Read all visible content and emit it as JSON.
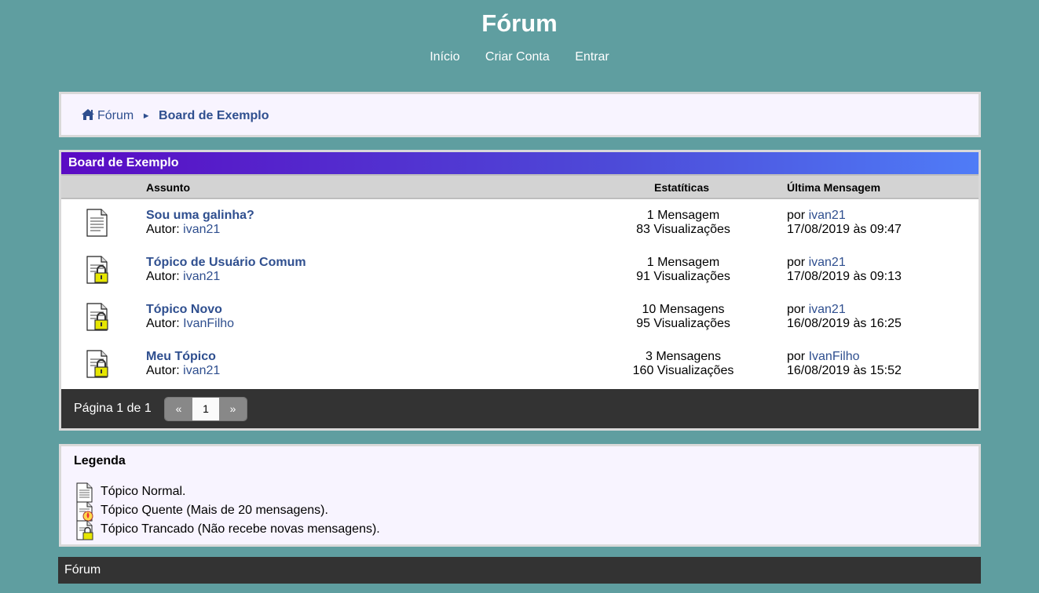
{
  "site": {
    "title": "Fórum"
  },
  "nav": {
    "home": "Início",
    "register": "Criar Conta",
    "login": "Entrar"
  },
  "breadcrumb": {
    "root": "Fórum",
    "separator": "►",
    "current": "Board de Exemplo"
  },
  "board": {
    "title": "Board de Exemplo",
    "columns": {
      "subject": "Assunto",
      "stats": "Estatíticas",
      "last": "Última Mensagem"
    },
    "topics": [
      {
        "icon": "normal-topic-icon",
        "title": "Sou uma galinha?",
        "author_label": "Autor:",
        "author": "ivan21",
        "messages": "1 Mensagem",
        "views": "83 Visualizações",
        "last_by_label": "por",
        "last_by": "ivan21",
        "last_date": "17/08/2019 às 09:47"
      },
      {
        "icon": "locked-topic-icon",
        "title": "Tópico de Usuário Comum",
        "author_label": "Autor:",
        "author": "ivan21",
        "messages": "1 Mensagem",
        "views": "91 Visualizações",
        "last_by_label": "por",
        "last_by": "ivan21",
        "last_date": "17/08/2019 às 09:13"
      },
      {
        "icon": "locked-topic-icon",
        "title": "Tópico Novo",
        "author_label": "Autor:",
        "author": "IvanFilho",
        "messages": "10 Mensagens",
        "views": "95 Visualizações",
        "last_by_label": "por",
        "last_by": "ivan21",
        "last_date": "16/08/2019 às 16:25"
      },
      {
        "icon": "locked-topic-icon",
        "title": "Meu Tópico",
        "author_label": "Autor:",
        "author": "ivan21",
        "messages": "3 Mensagens",
        "views": "160 Visualizações",
        "last_by_label": "por",
        "last_by": "IvanFilho",
        "last_date": "16/08/2019 às 15:52"
      }
    ],
    "pagination": {
      "label": "Página 1 de 1",
      "prev": "«",
      "current": "1",
      "next": "»"
    }
  },
  "legend": {
    "title": "Legenda",
    "items": [
      {
        "icon": "normal-topic-icon",
        "label": "Tópico Normal."
      },
      {
        "icon": "hot-topic-icon",
        "label": "Tópico Quente (Mais de 20 mensagens)."
      },
      {
        "icon": "locked-topic-icon",
        "label": "Tópico Trancado (Não recebe novas mensagens)."
      }
    ]
  },
  "footer": {
    "text": "Fórum"
  },
  "colors": {
    "background": "#5f9ea0",
    "link": "#2f4f8f",
    "header_gradient_start": "#5a0bc4",
    "header_gradient_end": "#4f7cf7",
    "dark_bar": "#333333"
  }
}
